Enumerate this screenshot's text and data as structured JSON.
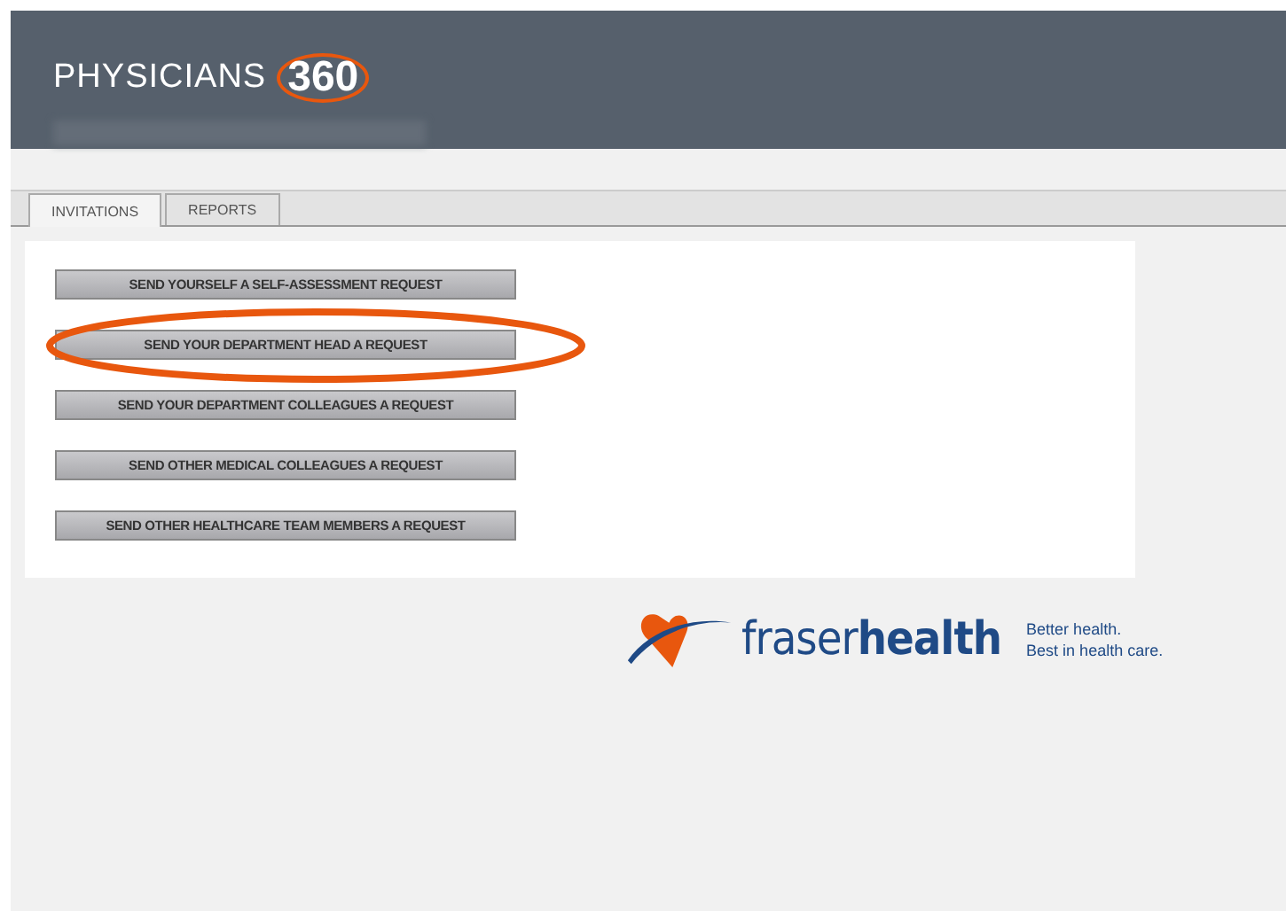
{
  "header": {
    "title": "PHYSICIANS",
    "title_number": "360"
  },
  "tabs": [
    {
      "label": "INVITATIONS",
      "selected": true
    },
    {
      "label": "REPORTS",
      "selected": false
    }
  ],
  "buttons": [
    {
      "label": "SEND YOURSELF A SELF-ASSESSMENT REQUEST",
      "highlighted": false
    },
    {
      "label": "SEND YOUR DEPARTMENT HEAD A REQUEST",
      "highlighted": true
    },
    {
      "label": "SEND YOUR DEPARTMENT COLLEAGUES A REQUEST",
      "highlighted": false
    },
    {
      "label": "SEND OTHER MEDICAL COLLEAGUES A REQUEST",
      "highlighted": false
    },
    {
      "label": "SEND OTHER HEALTHCARE TEAM MEMBERS A REQUEST",
      "highlighted": false
    }
  ],
  "footer_logo": {
    "name": "fraser**health**",
    "tagline": [
      "Better health.",
      "Best in health care."
    ]
  }
}
